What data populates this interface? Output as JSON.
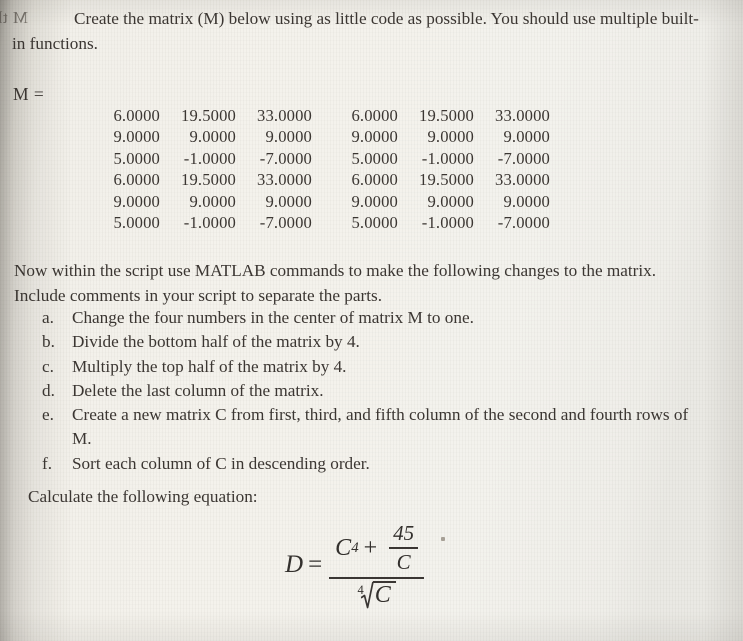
{
  "page": {
    "bleed_through_text": "M  th oo oCreate",
    "background_color": "#f2f0ea",
    "text_color": "#3b3632"
  },
  "intro": {
    "text": "Create the matrix (M) below using as little code as possible. You should use multiple built-in functions."
  },
  "matrix": {
    "label": "M =",
    "rows": [
      [
        "6.0000",
        "19.5000",
        "33.0000",
        "6.0000",
        "19.5000",
        "33.0000"
      ],
      [
        "9.0000",
        "9.0000",
        "9.0000",
        "9.0000",
        "9.0000",
        "9.0000"
      ],
      [
        "5.0000",
        "-1.0000",
        "-7.0000",
        "5.0000",
        "-1.0000",
        "-7.0000"
      ],
      [
        "6.0000",
        "19.5000",
        "33.0000",
        "6.0000",
        "19.5000",
        "33.0000"
      ],
      [
        "9.0000",
        "9.0000",
        "9.0000",
        "9.0000",
        "9.0000",
        "9.0000"
      ],
      [
        "5.0000",
        "-1.0000",
        "-7.0000",
        "5.0000",
        "-1.0000",
        "-7.0000"
      ]
    ]
  },
  "instructions": {
    "text": "Now within the script use MATLAB commands to make the following changes to the matrix. Include comments in your script to separate the parts."
  },
  "tasks": [
    {
      "marker": "a.",
      "text": "Change the four numbers in the center of matrix M to one."
    },
    {
      "marker": "b.",
      "text": "Divide the bottom half of the matrix by 4."
    },
    {
      "marker": "c.",
      "text": "Multiply the top half of the matrix by 4."
    },
    {
      "marker": "d.",
      "text": "Delete the last column of the matrix."
    },
    {
      "marker": "e.",
      "text": "Create a new matrix C from first, third, and fifth column of the second and fourth rows of M."
    },
    {
      "marker": "f.",
      "text": "Sort each column of C in descending order."
    }
  ],
  "calculate": {
    "text": "Calculate the following equation:"
  },
  "equation": {
    "lhs": "D",
    "equals": "=",
    "numerator_base": "C",
    "numerator_exponent": "4",
    "plus": "+",
    "inner_numerator": "45",
    "inner_denominator": "C",
    "root_index": "4",
    "root_radicand": "C",
    "plain_text": "D = (C^4 + 45/C) / (4th-root of C)"
  }
}
